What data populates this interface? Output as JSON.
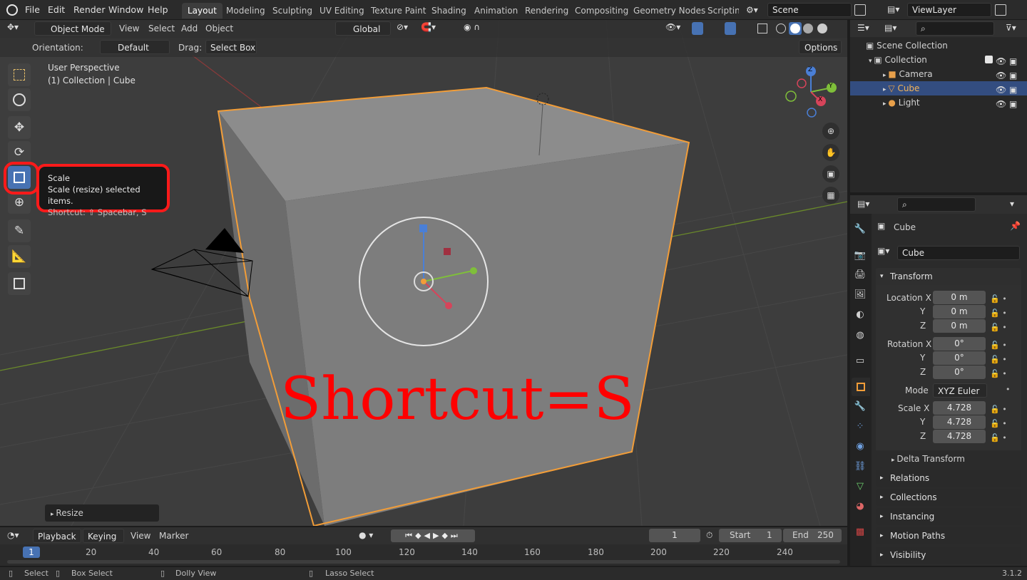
{
  "menu": {
    "file": "File",
    "edit": "Edit",
    "render": "Render",
    "window": "Window",
    "help": "Help"
  },
  "workspaces": [
    "Layout",
    "Modeling",
    "Sculpting",
    "UV Editing",
    "Texture Paint",
    "Shading",
    "Animation",
    "Rendering",
    "Compositing",
    "Geometry Nodes",
    "Scripting"
  ],
  "scene": "Scene",
  "viewlayer": "ViewLayer",
  "vp_header": {
    "mode": "Object Mode",
    "view": "View",
    "select": "Select",
    "add": "Add",
    "object": "Object",
    "orientation": "Global"
  },
  "tool_settings": {
    "orientation_label": "Orientation:",
    "orientation_value": "Default",
    "drag_label": "Drag:",
    "drag_value": "Select Box",
    "options": "Options"
  },
  "overlay_info": {
    "line1": "User Perspective",
    "line2": "(1) Collection | Cube"
  },
  "tooltip": {
    "title": "Scale",
    "desc": "Scale (resize) selected items.",
    "shortcut": "Shortcut: ⇧ Spacebar, S"
  },
  "annotation": "Shortcut=S",
  "gizmo": {
    "x": "X",
    "y": "Y",
    "z": "Z"
  },
  "last_op": "Resize",
  "outliner": {
    "scene_collection": "Scene Collection",
    "collection": "Collection",
    "items": [
      "Camera",
      "Cube",
      "Light"
    ]
  },
  "properties": {
    "object_name": "Cube",
    "data_name": "Cube",
    "transform": "Transform",
    "location_label": "Location X",
    "loc": [
      "0 m",
      "0 m",
      "0 m"
    ],
    "rotation_label": "Rotation X",
    "rot": [
      "0°",
      "0°",
      "0°"
    ],
    "y": "Y",
    "z": "Z",
    "mode_label": "Mode",
    "mode_value": "XYZ Euler",
    "scale_label": "Scale X",
    "scale": [
      "4.728",
      "4.728",
      "4.728"
    ],
    "delta": "Delta Transform",
    "panels": [
      "Relations",
      "Collections",
      "Instancing",
      "Motion Paths",
      "Visibility"
    ]
  },
  "timeline": {
    "playback": "Playback",
    "keying": "Keying",
    "view": "View",
    "marker": "Marker",
    "frame": "1",
    "start_label": "Start",
    "start": "1",
    "end_label": "End",
    "end": "250",
    "ticks": [
      "20",
      "40",
      "60",
      "80",
      "100",
      "120",
      "140",
      "160",
      "180",
      "200",
      "220",
      "240"
    ],
    "current": "1"
  },
  "status": {
    "select": "Select",
    "box_select": "Box Select",
    "dolly": "Dolly View",
    "lasso": "Lasso Select",
    "version": "3.1.2"
  },
  "colors": {
    "accent": "#4772b3",
    "selected_outline": "#f29d38",
    "annotation": "#ff0000"
  }
}
